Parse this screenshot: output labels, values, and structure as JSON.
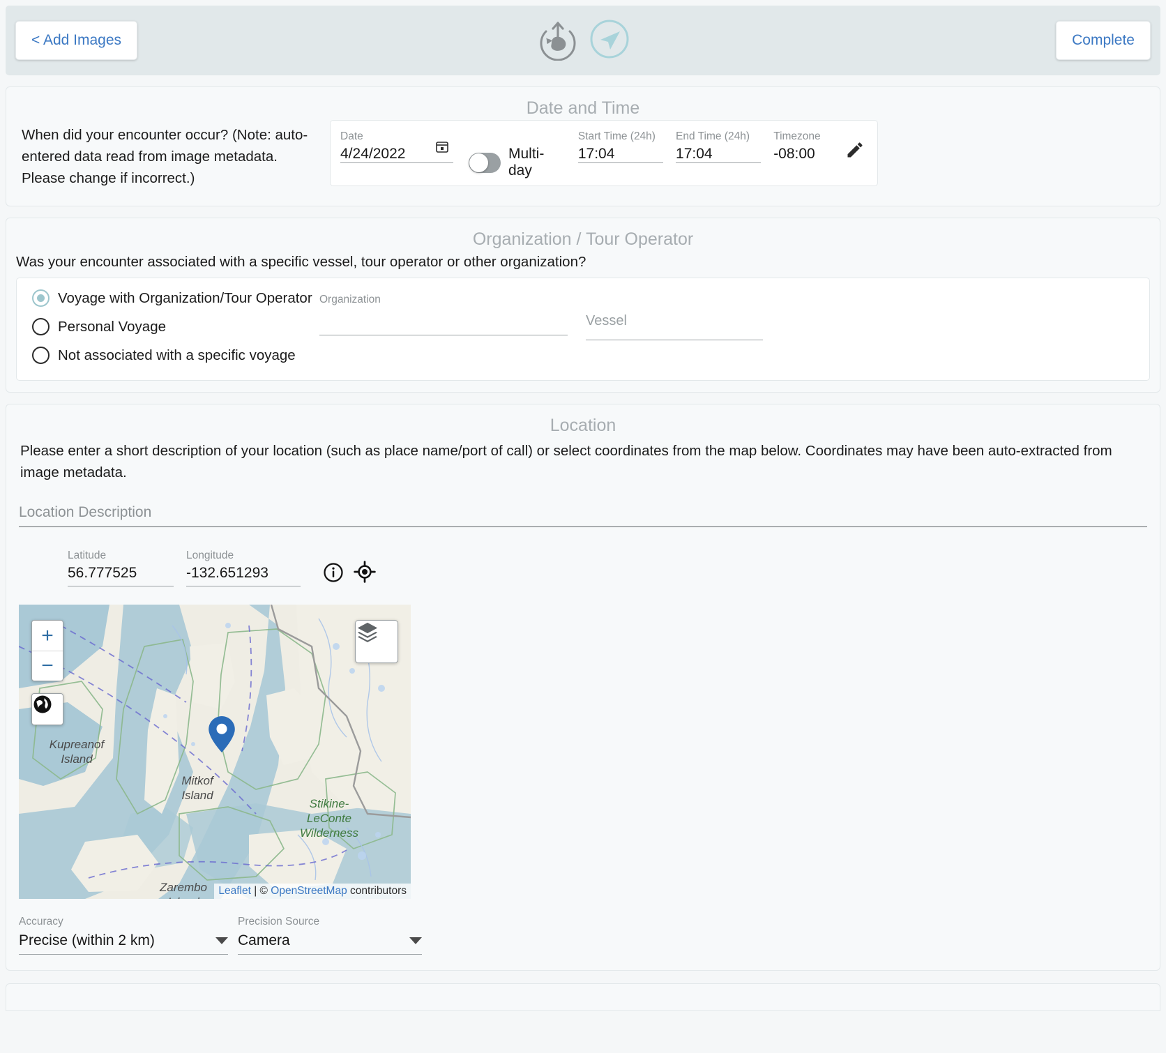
{
  "topbar": {
    "add_images_label": "< Add Images",
    "complete_label": "Complete",
    "logo_icon": "whale-upload-icon",
    "nav_icon": "navigation-arrow-icon"
  },
  "date_time": {
    "title": "Date and Time",
    "question": "When did your encounter occur? (Note: auto-entered data read from image metadata. Please change if incorrect.)",
    "date_label": "Date",
    "date_value": "4/24/2022",
    "calendar_icon": "calendar-icon",
    "multiday_label": "Multi-day",
    "multiday_on": false,
    "start_time_label": "Start Time (24h)",
    "start_time_value": "17:04",
    "end_time_label": "End Time (24h)",
    "end_time_value": "17:04",
    "timezone_label": "Timezone",
    "timezone_value": "-08:00",
    "edit_icon": "pencil-edit-icon"
  },
  "organization": {
    "title": "Organization / Tour Operator",
    "question": "Was your encounter associated with a specific vessel, tour operator or other organization?",
    "options": [
      {
        "label": "Voyage with Organization/Tour Operator",
        "selected": true
      },
      {
        "label": "Personal Voyage",
        "selected": false
      },
      {
        "label": "Not associated with a specific voyage",
        "selected": false
      }
    ],
    "organization_label": "Organization",
    "organization_value": "",
    "vessel_placeholder": "Vessel",
    "vessel_value": ""
  },
  "location": {
    "title": "Location",
    "description": "Please enter a short description of your location (such as place name/port of call) or select coordinates from the map below. Coordinates may have been auto-extracted from image metadata.",
    "location_description_placeholder": "Location Description",
    "location_description_value": "",
    "latitude_label": "Latitude",
    "latitude_value": "56.777525",
    "longitude_label": "Longitude",
    "longitude_value": "-132.651293",
    "info_icon": "info-circle-icon",
    "crosshair_icon": "crosshair-target-icon",
    "map": {
      "zoom_in_label": "+",
      "zoom_out_label": "−",
      "globe_icon": "globe-icon",
      "layers_icon": "layers-stack-icon",
      "marker_icon": "map-pin-marker",
      "attribution_leaflet": "Leaflet",
      "attribution_separator": " | © ",
      "attribution_osm": "OpenStreetMap",
      "attribution_tail": " contributors",
      "labels": [
        "Kupreanof\nIsland",
        "Mitkof\nIsland",
        "Stikine-\nLeConte\nWilderness",
        "Zarembo\nIsland"
      ]
    },
    "accuracy_label": "Accuracy",
    "accuracy_value": "Precise (within 2 km)",
    "precision_source_label": "Precision Source",
    "precision_source_value": "Camera"
  },
  "colors": {
    "accent_blue": "#3b78c3",
    "topbar_bg": "#e1e8ea",
    "teal": "#9dc6cd",
    "marker_blue": "#2b6cb8"
  }
}
